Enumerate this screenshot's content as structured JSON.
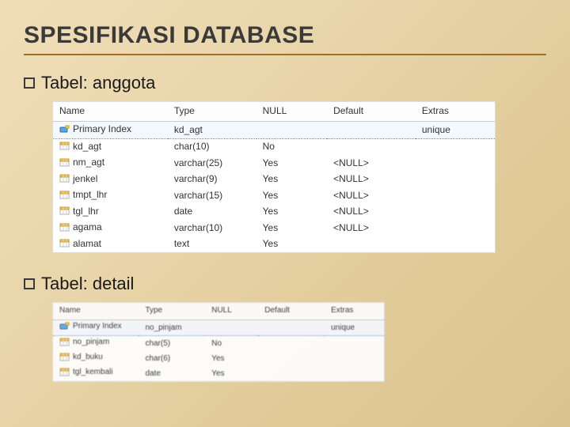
{
  "slide": {
    "title": "SPESIFIKASI DATABASE"
  },
  "sections": [
    {
      "label_prefix": "Tabel:",
      "label_name": "anggota"
    },
    {
      "label_prefix": "Tabel:",
      "label_name": "detail"
    }
  ],
  "headers": {
    "name": "Name",
    "type": "Type",
    "null": "NULL",
    "default": "Default",
    "extras": "Extras"
  },
  "table_anggota": {
    "rows": [
      {
        "kind": "index",
        "name": "Primary Index",
        "type": "kd_agt",
        "null": "",
        "default": "",
        "extras": "unique"
      },
      {
        "kind": "column",
        "name": "kd_agt",
        "type": "char(10)",
        "null": "No",
        "default": "",
        "extras": ""
      },
      {
        "kind": "column",
        "name": "nm_agt",
        "type": "varchar(25)",
        "null": "Yes",
        "default": "<NULL>",
        "extras": ""
      },
      {
        "kind": "column",
        "name": "jenkel",
        "type": "varchar(9)",
        "null": "Yes",
        "default": "<NULL>",
        "extras": ""
      },
      {
        "kind": "column",
        "name": "tmpt_lhr",
        "type": "varchar(15)",
        "null": "Yes",
        "default": "<NULL>",
        "extras": ""
      },
      {
        "kind": "column",
        "name": "tgl_lhr",
        "type": "date",
        "null": "Yes",
        "default": "<NULL>",
        "extras": ""
      },
      {
        "kind": "column",
        "name": "agama",
        "type": "varchar(10)",
        "null": "Yes",
        "default": "<NULL>",
        "extras": ""
      },
      {
        "kind": "column",
        "name": "alamat",
        "type": "text",
        "null": "Yes",
        "default": "",
        "extras": ""
      }
    ]
  },
  "table_detail": {
    "rows": [
      {
        "kind": "index",
        "name": "Primary Index",
        "type": "no_pinjam",
        "null": "",
        "default": "",
        "extras": "unique"
      },
      {
        "kind": "column",
        "name": "no_pinjam",
        "type": "char(5)",
        "null": "No",
        "default": "",
        "extras": ""
      },
      {
        "kind": "column",
        "name": "kd_buku",
        "type": "char(6)",
        "null": "Yes",
        "default": "",
        "extras": ""
      },
      {
        "kind": "column",
        "name": "tgl_kembali",
        "type": "date",
        "null": "Yes",
        "default": "",
        "extras": ""
      }
    ]
  }
}
